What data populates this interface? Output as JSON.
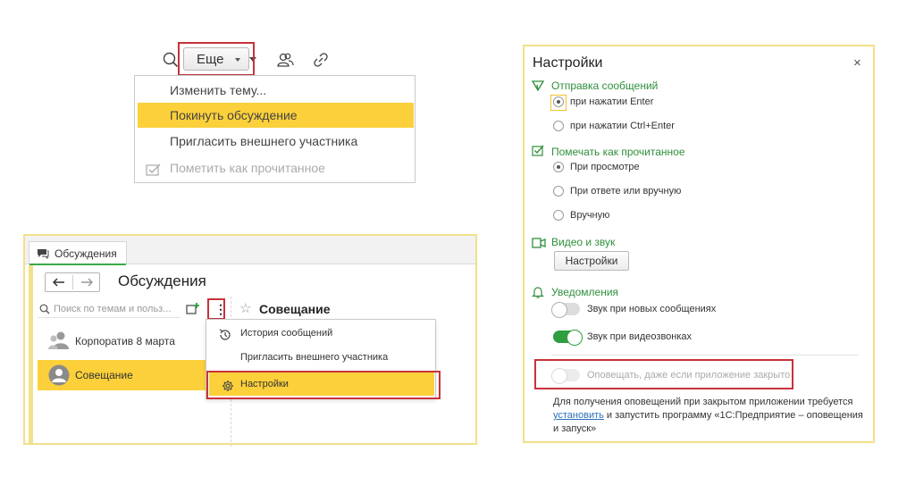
{
  "top_menu_demo": {
    "toolbar": {
      "icons": [
        "search-icon",
        "video-icon",
        "bell-icon",
        "chevron-down-icon",
        "users-icon",
        "link-icon"
      ],
      "more_label": "Еще"
    },
    "menu": {
      "items": [
        {
          "label": "Изменить тему...",
          "state": "normal"
        },
        {
          "label": "Покинуть обсуждение",
          "state": "active"
        },
        {
          "label": "Пригласить внешнего участника",
          "state": "normal"
        },
        {
          "label": "Пометить как прочитанное",
          "state": "disabled",
          "icon": "check-message-icon"
        }
      ]
    }
  },
  "discussions_window": {
    "tab_label": "Обсуждения",
    "title": "Обсуждения",
    "search_placeholder": "Поиск по темам и польз...",
    "conversations": [
      {
        "label": "Корпоратив 8 марта",
        "active": false
      },
      {
        "label": "Совещание",
        "active": true
      }
    ],
    "current_title": "Совещание",
    "context_menu": {
      "items": [
        {
          "label": "История сообщений",
          "icon": "history-icon"
        },
        {
          "label": "Пригласить внешнего участника",
          "icon": ""
        },
        {
          "label": "Настройки",
          "icon": "gear-icon",
          "active": true
        }
      ]
    }
  },
  "settings_panel": {
    "title": "Настройки",
    "close": "×",
    "send": {
      "heading": "Отправка сообщений",
      "options": [
        "при нажатии Enter",
        "при нажатии Ctrl+Enter"
      ],
      "selected": 0
    },
    "mark_read": {
      "heading": "Помечать как прочитанное",
      "options": [
        "При просмотре",
        "При ответе или вручную",
        "Вручную"
      ],
      "selected": 0
    },
    "video": {
      "heading": "Видео и звук",
      "button": "Настройки"
    },
    "notifications": {
      "heading": "Уведомления",
      "toggles": [
        {
          "label": "Звук при новых сообщениях",
          "on": false,
          "disabled": false
        },
        {
          "label": "Звук при видеозвонках",
          "on": true,
          "disabled": false
        },
        {
          "label": "Оповещать, даже если приложение закрыто",
          "on": false,
          "disabled": true
        }
      ]
    },
    "note": {
      "text_before": "Для получения оповещений при закрытом приложении требуется",
      "link": "установить",
      "text_after": "и запустить программу «1С:Предприятие – оповещения и запуск»"
    },
    "accent_color": "#2f8f3b"
  },
  "colors": {
    "highlight": "#fbd03a",
    "frame_red": "#c8323a",
    "window_border": "#f2e08a"
  }
}
